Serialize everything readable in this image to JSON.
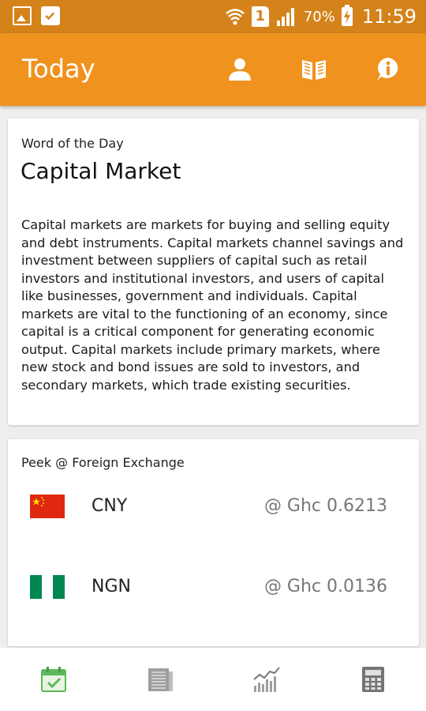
{
  "status_bar": {
    "battery": "70%",
    "time": "11:59",
    "sim_label": "1"
  },
  "app_bar": {
    "title": "Today",
    "icons": [
      "person-icon",
      "book-icon",
      "info-icon"
    ]
  },
  "word_of_day": {
    "label": "Word of the Day",
    "title": "Capital Market",
    "body": "Capital markets are markets for buying and selling equity and debt instruments. Capital markets channel savings and investment between suppliers of capital such as retail investors and institutional investors, and users of capital like businesses, government and individuals. Capital markets are vital to the functioning of an economy, since capital is a critical component for generating economic output. Capital markets include primary markets, where new stock and bond issues are sold to investors, and secondary markets, which trade existing securities."
  },
  "forex": {
    "label": "Peek @ Foreign Exchange",
    "rows": [
      {
        "code": "CNY",
        "rate": "@ Ghc 0.6213",
        "flag": "china-flag"
      },
      {
        "code": "NGN",
        "rate": "@ Ghc 0.0136",
        "flag": "nigeria-flag"
      }
    ]
  },
  "bottom_nav": {
    "items": [
      "calendar-check-icon",
      "newspaper-icon",
      "chart-icon",
      "calculator-icon"
    ]
  },
  "colors": {
    "status_bar": "#d4831a",
    "app_bar": "#f0921e",
    "accent_green": "#5cb85c"
  }
}
